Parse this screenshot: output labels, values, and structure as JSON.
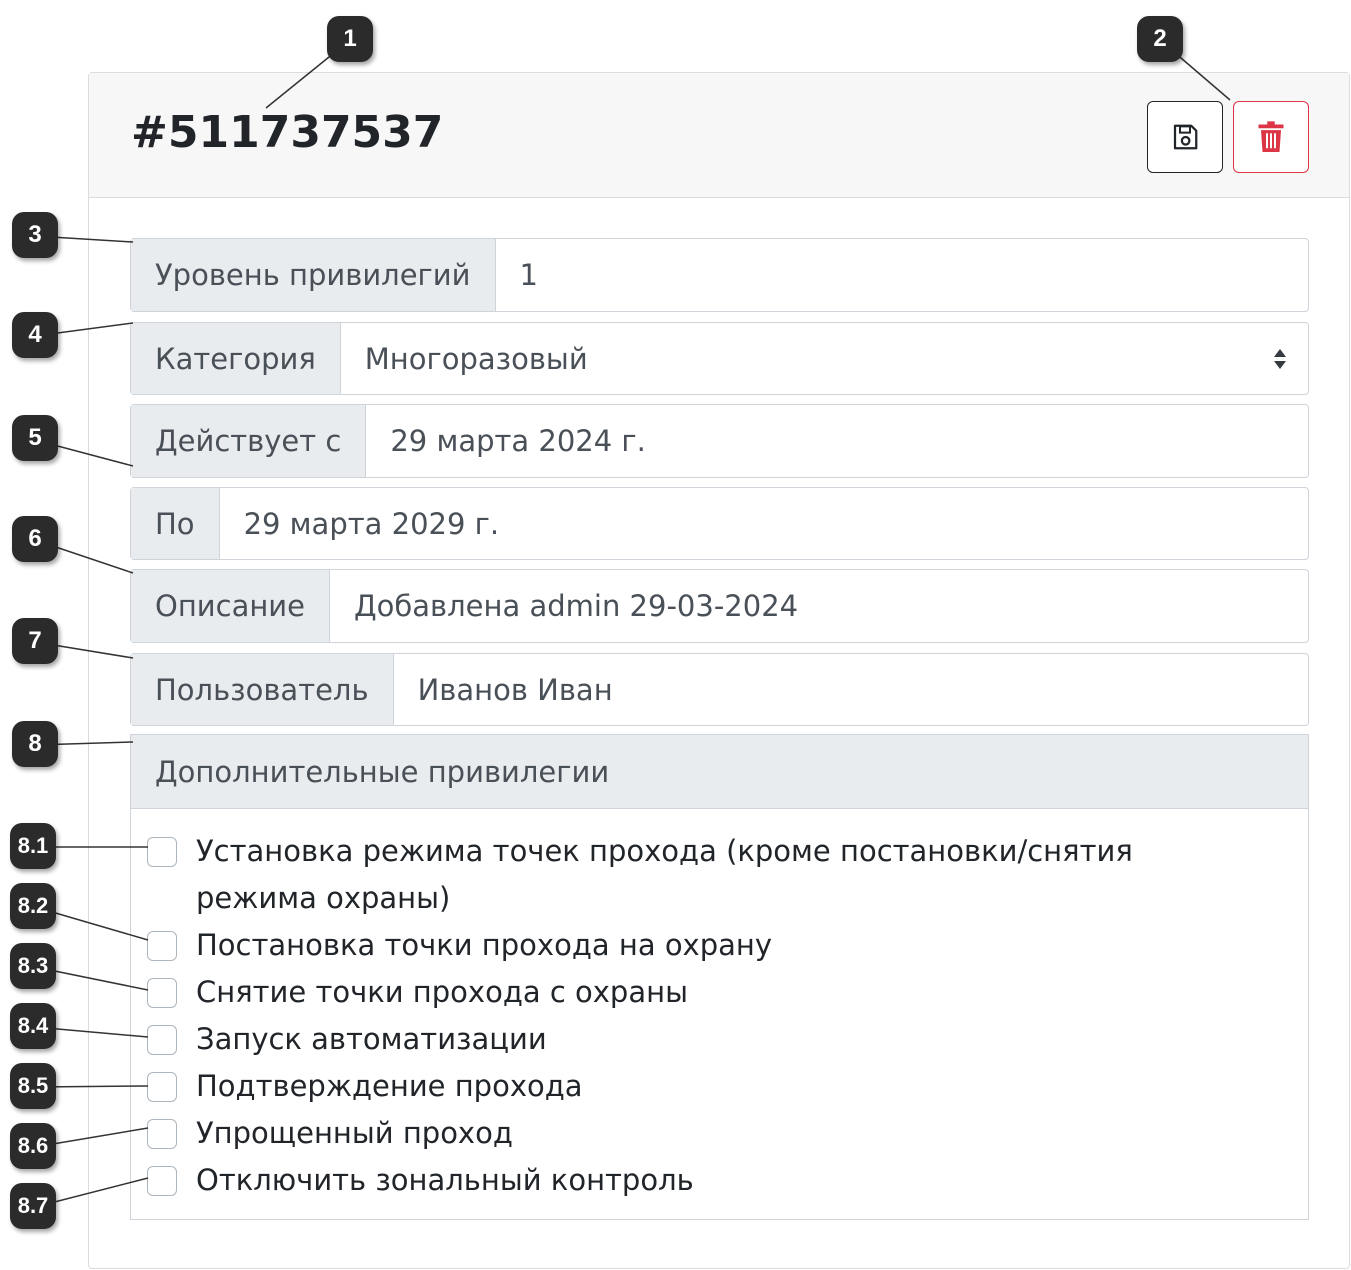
{
  "card": {
    "title": "#511737537",
    "buttons": {
      "save_icon": "floppy-disk-icon",
      "delete_icon": "trash-icon",
      "delete_color": "#dc3545"
    }
  },
  "fields": {
    "level_label": "Уровень привилегий",
    "level_value": "1",
    "category_label": "Категория",
    "category_value": "Многоразовый",
    "valid_from_label": "Действует с",
    "valid_from_value": "29 марта 2024 г.",
    "valid_to_label": "По",
    "valid_to_value": "29 марта 2029 г.",
    "description_label": "Описание",
    "description_value": "Добавлена admin 29-03-2024",
    "user_label": "Пользователь",
    "user_value": "Иванов Иван"
  },
  "privileges": {
    "header": "Дополнительные привилегии",
    "items": [
      {
        "label": "Установка режима точек прохода (кроме постановки/снятия режима охраны)",
        "checked": false
      },
      {
        "label": "Постановка точки прохода на охрану",
        "checked": false
      },
      {
        "label": "Снятие точки прохода с охраны",
        "checked": false
      },
      {
        "label": "Запуск автоматизации",
        "checked": false
      },
      {
        "label": "Подтверждение прохода",
        "checked": false
      },
      {
        "label": "Упрощенный проход",
        "checked": false
      },
      {
        "label": "Отключить зональный контроль",
        "checked": false
      }
    ]
  },
  "callouts": [
    "1",
    "2",
    "3",
    "4",
    "5",
    "6",
    "7",
    "8",
    "8.1",
    "8.2",
    "8.3",
    "8.4",
    "8.5",
    "8.6",
    "8.7"
  ]
}
